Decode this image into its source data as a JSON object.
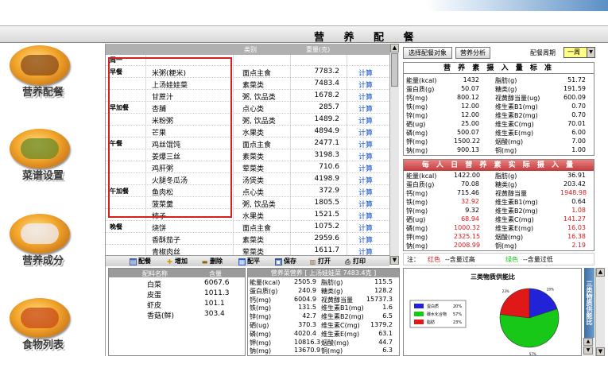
{
  "window": {
    "title": "营 养 配 餐"
  },
  "sidebar": {
    "items": [
      {
        "label": "营养配餐",
        "icon": "food-plate-icon"
      },
      {
        "label": "菜谱设置",
        "icon": "dish-bowl-icon"
      },
      {
        "label": "营养成分",
        "icon": "chef-icon"
      },
      {
        "label": "食物列表",
        "icon": "food-list-icon"
      }
    ]
  },
  "grid": {
    "columns": [
      "周一",
      "菜名",
      "类别",
      "重量(克)",
      ""
    ],
    "rows": [
      {
        "meal": "周一",
        "name": "",
        "cat": "",
        "val": "",
        "act": ""
      },
      {
        "meal": "早餐",
        "name": "米粥(粳米)",
        "cat": "面点主食",
        "val": "7783.2",
        "act": "计算"
      },
      {
        "meal": "",
        "name": "上汤娃娃菜",
        "cat": "素菜类",
        "val": "7483.4",
        "act": "计算"
      },
      {
        "meal": "",
        "name": "甘蔗汁",
        "cat": "粥, 饮品类",
        "val": "1678.2",
        "act": "计算"
      },
      {
        "meal": "早加餐",
        "name": "杏脯",
        "cat": "点心类",
        "val": "285.7",
        "act": "计算"
      },
      {
        "meal": "",
        "name": "米粉粥",
        "cat": "粥, 饮品类",
        "val": "1489.2",
        "act": "计算"
      },
      {
        "meal": "",
        "name": "芒果",
        "cat": "水果类",
        "val": "4894.9",
        "act": "计算"
      },
      {
        "meal": "午餐",
        "name": "鸡丝馄饨",
        "cat": "面点主食",
        "val": "2477.1",
        "act": "计算"
      },
      {
        "meal": "",
        "name": "姜爆三丝",
        "cat": "素菜类",
        "val": "3198.3",
        "act": "计算"
      },
      {
        "meal": "",
        "name": "鸡肝粥",
        "cat": "荤菜类",
        "val": "710.6",
        "act": "计算"
      },
      {
        "meal": "",
        "name": "火腿冬瓜汤",
        "cat": "汤煲类",
        "val": "4198.9",
        "act": "计算"
      },
      {
        "meal": "午加餐",
        "name": "鱼肉松",
        "cat": "点心类",
        "val": "372.9",
        "act": "计算"
      },
      {
        "meal": "",
        "name": "菠菜羹",
        "cat": "粥, 饮品类",
        "val": "1805.5",
        "act": "计算"
      },
      {
        "meal": "",
        "name": "柿子",
        "cat": "水果类",
        "val": "1521.5",
        "act": "计算"
      },
      {
        "meal": "晚餐",
        "name": "烧饼",
        "cat": "面点主食",
        "val": "1075.2",
        "act": "计算"
      },
      {
        "meal": "",
        "name": "香酥茄子",
        "cat": "素菜类",
        "val": "2959.6",
        "act": "计算"
      },
      {
        "meal": "",
        "name": "青椒肉丝",
        "cat": "荤菜类",
        "val": "1611.7",
        "act": "计算"
      }
    ]
  },
  "toolbar": {
    "buttons": [
      {
        "label": "配餐",
        "icon": "meal-icon"
      },
      {
        "label": "增加",
        "icon": "add-icon"
      },
      {
        "label": "删除",
        "icon": "delete-icon"
      },
      {
        "label": "配平",
        "icon": "balance-icon"
      },
      {
        "label": "保存",
        "icon": "save-icon"
      },
      {
        "label": "打开",
        "icon": "open-icon"
      },
      {
        "label": "打印",
        "icon": "print-icon"
      }
    ]
  },
  "ingredients": {
    "headers": [
      "配料名称",
      "含量"
    ],
    "rows": [
      {
        "name": "白菜",
        "amount": "6067.6"
      },
      {
        "name": "皮蛋",
        "amount": "1011.3"
      },
      {
        "name": "虾皮",
        "amount": "101.1"
      },
      {
        "name": "香菇(鲜)",
        "amount": "303.4"
      }
    ]
  },
  "dish_nutrition": {
    "title": "营养菜营养 [ 上汤娃娃菜 7483.4克 ]",
    "rows": [
      [
        "能量(kcal)",
        "2505.9",
        "脂肪(g)",
        "115.5"
      ],
      [
        "蛋白质(g)",
        "240.9",
        "糖类(g)",
        "128.2"
      ],
      [
        "钙(mg)",
        "6004.9",
        "视黄醇当量",
        "15737.3"
      ],
      [
        "铁(mg)",
        "131.5",
        "维生素B1(mg)",
        "1.6"
      ],
      [
        "锌(mg)",
        "42.7",
        "维生素B2(mg)",
        "6.5"
      ],
      [
        "硒(ug)",
        "370.3",
        "维生素C(mg)",
        "1379.2"
      ],
      [
        "磷(mg)",
        "4020.4",
        "维生素E(mg)",
        "63.1"
      ],
      [
        "钾(mg)",
        "10816.3",
        "烟酸(mg)",
        "44.7"
      ],
      [
        "钠(mg)",
        "13670.9",
        "铜(mg)",
        "6.3"
      ]
    ]
  },
  "controls": {
    "select_target": "选择配餐对象",
    "analysis": "营养分析",
    "period_label": "配餐周期",
    "period_value": "一周"
  },
  "standard": {
    "title": "营 养 素 摄 入 量 标 准",
    "rows": [
      [
        "能量(kcal)",
        "1432",
        "脂肪(g)",
        "51.72"
      ],
      [
        "蛋白质(g)",
        "50.07",
        "糖类(g)",
        "191.59"
      ],
      [
        "钙(mg)",
        "800.12",
        "视黄醇当量(ug)",
        "600.09"
      ],
      [
        "铁(mg)",
        "12.00",
        "维生素B1(mg)",
        "0.70"
      ],
      [
        "锌(mg)",
        "12.00",
        "维生素B2(mg)",
        "0.70"
      ],
      [
        "硒(ug)",
        "25.00",
        "维生素C(mg)",
        "70.01"
      ],
      [
        "磷(mg)",
        "500.07",
        "维生素E(mg)",
        "6.00"
      ],
      [
        "钾(mg)",
        "1500.22",
        "烟酸(mg)",
        "7.00"
      ],
      [
        "钠(mg)",
        "900.13",
        "铜(mg)",
        "1.00"
      ]
    ]
  },
  "actual": {
    "title": "每 人 日 营 养 素 实 际 摄 入 量",
    "rows": [
      [
        "能量(kcal)",
        "1422.00",
        "",
        "脂肪(g)",
        "36.91",
        ""
      ],
      [
        "蛋白质(g)",
        "70.08",
        "",
        "糖类(g)",
        "203.42",
        ""
      ],
      [
        "钙(mg)",
        "715.46",
        "",
        "视黄醇当量",
        "1948.98",
        "high"
      ],
      [
        "铁(mg)",
        "32.92",
        "high",
        "维生素B1(mg)",
        "0.64",
        ""
      ],
      [
        "锌(mg)",
        "9.32",
        "",
        "维生素B2(mg)",
        "1.08",
        "high"
      ],
      [
        "硒(ug)",
        "68.94",
        "high",
        "维生素C(mg)",
        "141.27",
        "high"
      ],
      [
        "磷(mg)",
        "1000.32",
        "high",
        "维生素E(mg)",
        "16.03",
        "high"
      ],
      [
        "钾(mg)",
        "2325.15",
        "high",
        "烟酸(mg)",
        "16.38",
        "high"
      ],
      [
        "钠(mg)",
        "2008.99",
        "high",
        "铜(mg)",
        "2.19",
        "high"
      ]
    ]
  },
  "legend": {
    "note": "注：",
    "red_word": "红色",
    "red_desc": "--含量过高",
    "green_word": "绿色",
    "green_desc": "--含量过低"
  },
  "chart_data": {
    "type": "pie",
    "title": "三类物质供能比",
    "series": [
      {
        "name": "蛋白质",
        "value": 20,
        "label": "20%",
        "color": "#2222d8"
      },
      {
        "name": "碳水化合物",
        "value": 57,
        "label": "57%",
        "color": "#18c818"
      },
      {
        "name": "脂肪",
        "value": 23,
        "label": "23%",
        "color": "#e01818"
      }
    ]
  },
  "side_tab": {
    "label": "三类物质供能比"
  },
  "colors": {
    "high": "#e01818",
    "low": "#18a818",
    "link": "#1450c8",
    "accent": "#c23c3c"
  }
}
